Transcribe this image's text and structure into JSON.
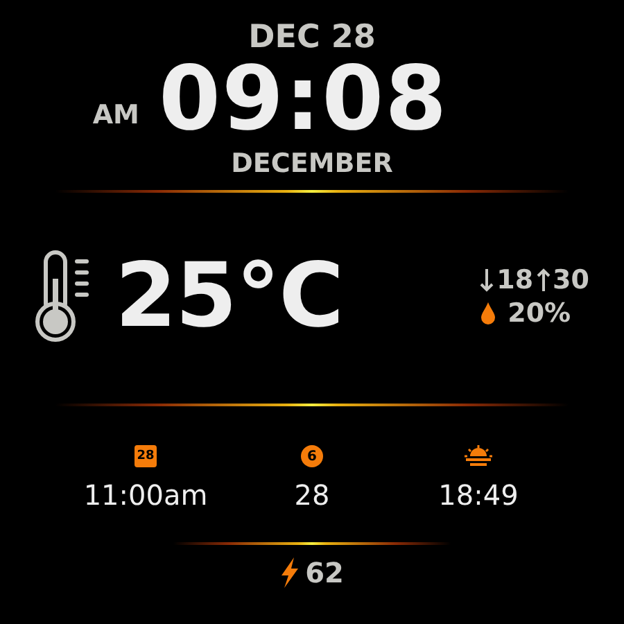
{
  "date": "DEC 28",
  "meridiem": "AM",
  "time": "09:08",
  "month": "DECEMBER",
  "weather": {
    "temperature": "25°C",
    "low": "18",
    "high": "30",
    "rain_chance": "20%"
  },
  "complications": [
    {
      "kind": "calendar",
      "badge": "28",
      "value": "11:00am"
    },
    {
      "kind": "count",
      "badge": "6",
      "value": "28"
    },
    {
      "kind": "sunset",
      "value": "18:49"
    }
  ],
  "battery": {
    "value": "62"
  }
}
